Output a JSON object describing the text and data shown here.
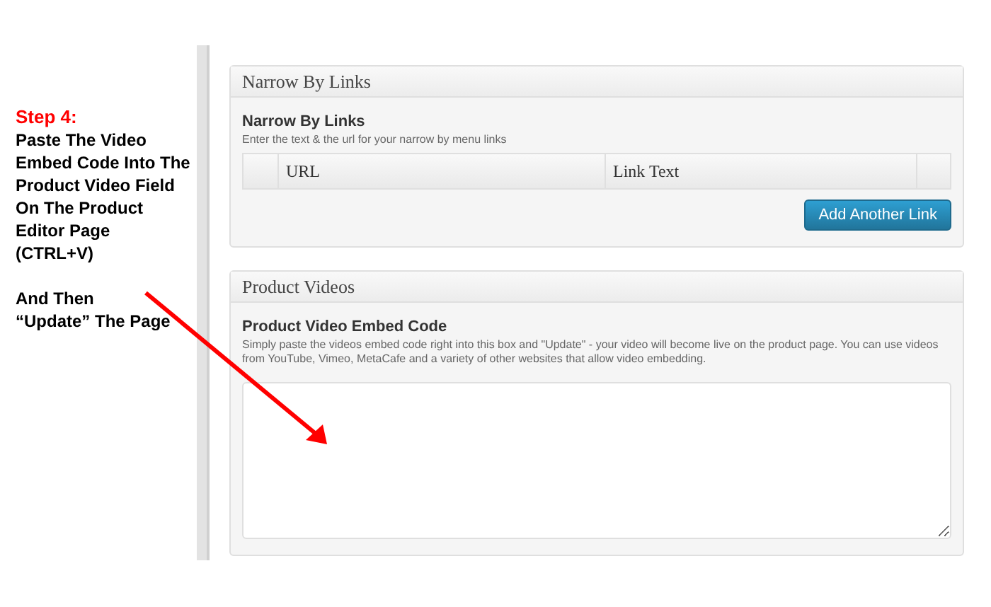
{
  "annotation": {
    "step": "Step 4:",
    "instructions": "Paste The Video Embed Code Into The Product Video Field On The Product Editor Page (CTRL+V)",
    "followup": "And Then “Update” The Page"
  },
  "panels": [
    {
      "kind": "table",
      "title": "Narrow By Links",
      "field_label": "Narrow By Links",
      "description": "Enter the text & the url for your narrow by menu links",
      "columns": [
        "URL",
        "Link Text"
      ],
      "button": "Add Another Link"
    },
    {
      "kind": "textarea",
      "title": "Product Videos",
      "field_label": "Product Video Embed Code",
      "description": "Simply paste the videos embed code right into this box and \"Update\" - your video will become live on the product page. You can use videos from YouTube, Vimeo, MetaCafe and a variety of other websites that allow video embedding."
    }
  ]
}
